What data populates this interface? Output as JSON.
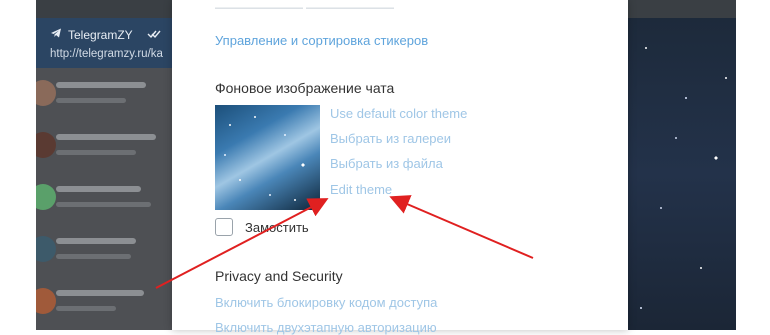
{
  "background_app": {
    "channel_name": "TelegramZY",
    "channel_url": "http://telegramzy.ru/ka"
  },
  "settings": {
    "stickers_link": "Управление и сортировка стикеров",
    "chat_background": {
      "title": "Фоновое изображение чата",
      "options": [
        "Use default color theme",
        "Выбрать из галереи",
        "Выбрать из файла",
        "Edit theme"
      ],
      "tile_label": "Замостить",
      "tile_checked": false
    },
    "privacy": {
      "title": "Privacy and Security",
      "links": [
        "Включить блокировку кодом доступа",
        "Включить двухэтапную авторизацию"
      ]
    }
  },
  "colors": {
    "link": "#5fa4dc",
    "annotation_arrow": "#e02020"
  },
  "icons": [
    "telegram-icon",
    "double-check-icon"
  ]
}
